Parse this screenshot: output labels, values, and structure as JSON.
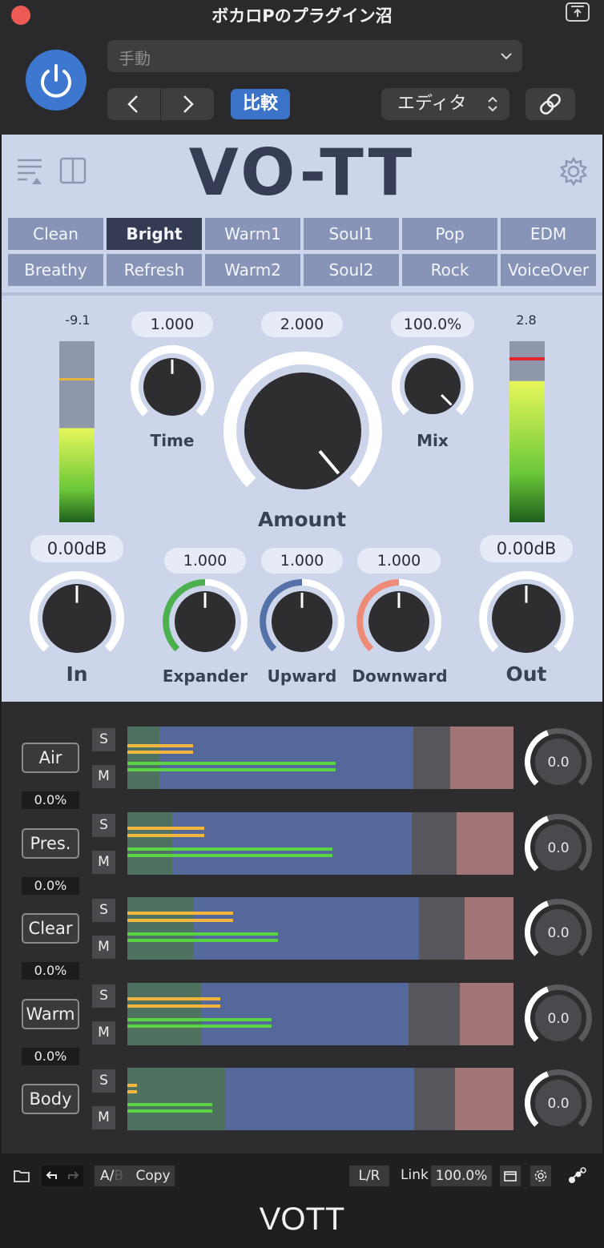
{
  "window": {
    "title": "ボカロPのプラグイン沼",
    "bottom_title": "VOTT"
  },
  "host": {
    "preset_value": "手動",
    "compare_label": "比較",
    "editor_label": "エディタ",
    "prev_symbol": "‹",
    "next_symbol": "›"
  },
  "plugin": {
    "logo": "VO-TT",
    "presets_row1": [
      "Clean",
      "Bright",
      "Warm1",
      "Soul1",
      "Pop",
      "EDM"
    ],
    "presets_row2": [
      "Breathy",
      "Refresh",
      "Warm2",
      "Soul2",
      "Rock",
      "VoiceOver"
    ],
    "active_preset": "Bright",
    "meters": {
      "in_peak": "-9.1",
      "out_peak": "2.8",
      "in_level": 0.52,
      "out_level": 0.78
    },
    "knobs": {
      "time": {
        "label": "Time",
        "value": "1.000"
      },
      "amount": {
        "label": "Amount",
        "value": "2.000"
      },
      "mix": {
        "label": "Mix",
        "value": "100.0%"
      },
      "in": {
        "label": "In",
        "value": "0.00dB"
      },
      "out": {
        "label": "Out",
        "value": "0.00dB"
      },
      "expander": {
        "label": "Expander",
        "value": "1.000"
      },
      "upward": {
        "label": "Upward",
        "value": "1.000"
      },
      "downward": {
        "label": "Downward",
        "value": "1.000"
      }
    },
    "colors": {
      "expander": "#4caf50",
      "upward": "#5572a8",
      "downward": "#ee8a78"
    }
  },
  "bands": [
    {
      "name": "Air",
      "pct": "0.0%",
      "knob": "0.0",
      "solo": "S",
      "mute": "M"
    },
    {
      "name": "Pres.",
      "pct": "0.0%",
      "knob": "0.0",
      "solo": "S",
      "mute": "M"
    },
    {
      "name": "Clear",
      "pct": "0.0%",
      "knob": "0.0",
      "solo": "S",
      "mute": "M"
    },
    {
      "name": "Warm",
      "pct": "0.0%",
      "knob": "0.0",
      "solo": "S",
      "mute": "M"
    },
    {
      "name": "Body",
      "pct": "",
      "knob": "0.0",
      "solo": "S",
      "mute": "M"
    }
  ],
  "footer": {
    "ab_a": "A",
    "ab_sep": "/",
    "ab_b": "B",
    "copy": "Copy",
    "lr": "L/R",
    "link_label": "Link",
    "link_value": "100.0%"
  }
}
